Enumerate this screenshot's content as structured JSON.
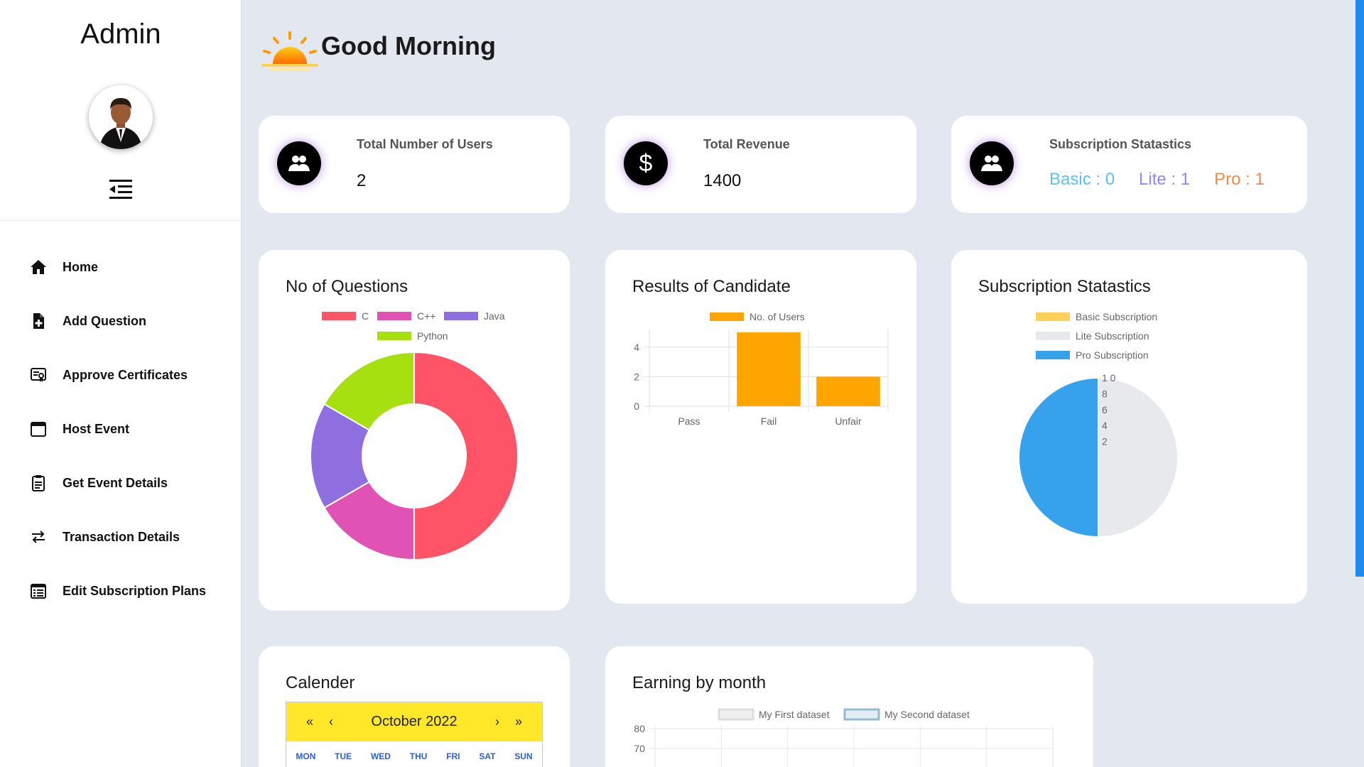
{
  "sidebar": {
    "title": "Admin",
    "items": [
      {
        "label": "Home",
        "icon": "home-icon"
      },
      {
        "label": "Add Question",
        "icon": "add-file-icon"
      },
      {
        "label": "Approve Certificates",
        "icon": "certificate-icon"
      },
      {
        "label": "Host Event",
        "icon": "calendar-icon"
      },
      {
        "label": "Get Event Details",
        "icon": "clipboard-icon"
      },
      {
        "label": "Transaction Details",
        "icon": "transfer-arrows-icon"
      },
      {
        "label": "Edit Subscription Plans",
        "icon": "calendar-list-icon"
      }
    ]
  },
  "header": {
    "greeting": "Good Morning"
  },
  "stats": {
    "users": {
      "title": "Total Number of Users",
      "value": "2"
    },
    "revenue": {
      "title": "Total Revenue",
      "value": "1400"
    },
    "subscription": {
      "title": "Subscription Statastics",
      "basic": "Basic : 0",
      "lite": "Lite : 1",
      "pro": "Pro : 1"
    }
  },
  "colors": {
    "basic": "#5cc0f2",
    "lite": "#9a84f5",
    "pro": "#ef8a4a",
    "bar": "#ffa500",
    "c": "#ff5468",
    "cpp": "#e152b5",
    "java": "#8f6ee0",
    "python": "#a6e010"
  },
  "questions_chart": {
    "title": "No of Questions",
    "chart_data": {
      "type": "pie",
      "categories": [
        "C",
        "C++",
        "Java",
        "Python"
      ],
      "values": [
        3,
        1,
        1,
        1
      ]
    }
  },
  "results_chart": {
    "title": "Results of Candidate",
    "chart_data": {
      "type": "bar",
      "categories": [
        "Pass",
        "Fail",
        "Unfair"
      ],
      "series": [
        {
          "name": "No. of Users",
          "values": [
            0,
            5,
            2
          ]
        }
      ],
      "ylim": [
        0,
        5
      ],
      "yticks": [
        "0",
        "2",
        "4"
      ]
    }
  },
  "subscription_chart": {
    "title": "Subscription Statastics",
    "chart_data": {
      "type": "pie",
      "categories": [
        "Basic Subscription",
        "Lite Subscription",
        "Pro Subscription"
      ],
      "values": [
        0,
        1,
        1
      ],
      "rticks": [
        "2",
        "4",
        "6",
        "8",
        "1 0"
      ]
    }
  },
  "calendar": {
    "title": "Calender",
    "month": "October 2022",
    "prev_year": "«",
    "prev_month": "‹",
    "next_month": "›",
    "next_year": "»",
    "weekdays": [
      "MON",
      "TUE",
      "WED",
      "THU",
      "FRI",
      "SAT",
      "SUN"
    ]
  },
  "earning_chart": {
    "title": "Earning by month",
    "chart_data": {
      "type": "line",
      "series": [
        {
          "name": "My First dataset",
          "values": []
        },
        {
          "name": "My Second dataset",
          "values": []
        }
      ],
      "yticks": [
        "80",
        "70"
      ]
    }
  }
}
